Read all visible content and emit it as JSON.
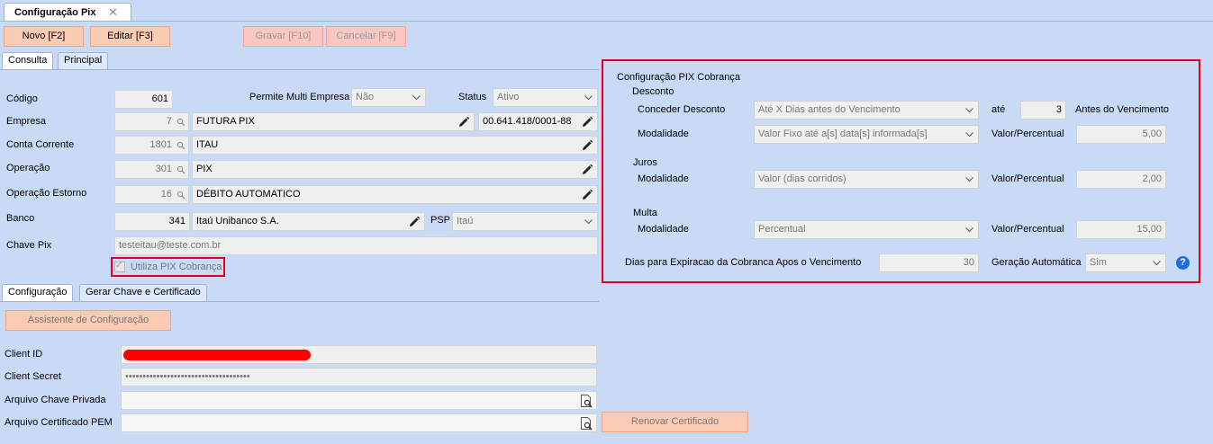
{
  "window": {
    "title": "Configuração Pix"
  },
  "toolbar": {
    "new_label": "Novo [F2]",
    "edit_label": "Editar [F3]",
    "save_label": "Gravar [F10]",
    "cancel_label": "Cancelar [F9]"
  },
  "tabs": {
    "consulta": "Consulta",
    "principal": "Principal"
  },
  "form": {
    "codigo_label": "Código",
    "codigo_value": "601",
    "multi_empresa_label": "Permite Multi Empresa",
    "multi_empresa_value": "Não",
    "status_label": "Status",
    "status_value": "Ativo",
    "empresa_label": "Empresa",
    "empresa_code": "7",
    "empresa_name": "FUTURA PIX",
    "empresa_cnpj": "00.641.418/0001-88",
    "conta_label": "Conta Corrente",
    "conta_code": "1801",
    "conta_name": "ITAU",
    "operacao_label": "Operação",
    "operacao_code": "301",
    "operacao_name": "PIX",
    "estorno_label": "Operação Estorno",
    "estorno_code": "16",
    "estorno_name": "DÉBITO AUTOMATICO",
    "banco_label": "Banco",
    "banco_code": "341",
    "banco_name": "Itaú Unibanco S.A.",
    "psp_label": "PSP",
    "psp_value": "Itaú",
    "chave_label": "Chave Pix",
    "chave_value": "testeitau@teste.com.br",
    "utiliza_label": "Utiliza PIX Cobrança"
  },
  "subtabs": {
    "configuracao": "Configuração",
    "gerar": "Gerar Chave e Certificado"
  },
  "config": {
    "assistente_label": "Assistente de Configuração",
    "client_id_label": "Client ID",
    "client_secret_label": "Client Secret",
    "client_secret_value": "••••••••••••••••••••••••••••••••••••",
    "chave_privada_label": "Arquivo Chave Privada",
    "certificado_label": "Arquivo Certificado PEM",
    "renovar_label": "Renovar Certificado"
  },
  "cobranca": {
    "title": "Configuração PIX Cobrança",
    "desconto_label": "Desconto",
    "conceder_label": "Conceder Desconto",
    "conceder_value": "Até X Dias antes do Vencimento",
    "ate_label": "até",
    "ate_value": "3",
    "antes_label": "Antes do Vencimento",
    "desc_modalidade_label": "Modalidade",
    "desc_modalidade_value": "Valor Fixo até a[s] data[s] informada[s]",
    "desc_valor_label": "Valor/Percentual",
    "desc_valor_value": "5,00",
    "juros_label": "Juros",
    "juros_modalidade_label": "Modalidade",
    "juros_modalidade_value": "Valor (dias corridos)",
    "juros_valor_label": "Valor/Percentual",
    "juros_valor_value": "2,00",
    "multa_label": "Multa",
    "multa_modalidade_label": "Modalidade",
    "multa_modalidade_value": "Percentual",
    "multa_valor_label": "Valor/Percentual",
    "multa_valor_value": "15,00",
    "dias_label": "Dias para Expiracao da Cobranca Apos o Vencimento",
    "dias_value": "30",
    "geracao_label": "Geração Automática",
    "geracao_value": "Sim"
  },
  "colors": {
    "background": "#c9daf7",
    "button": "#fbcbb4",
    "highlight": "#e3001b",
    "help": "#1e6fd9"
  }
}
